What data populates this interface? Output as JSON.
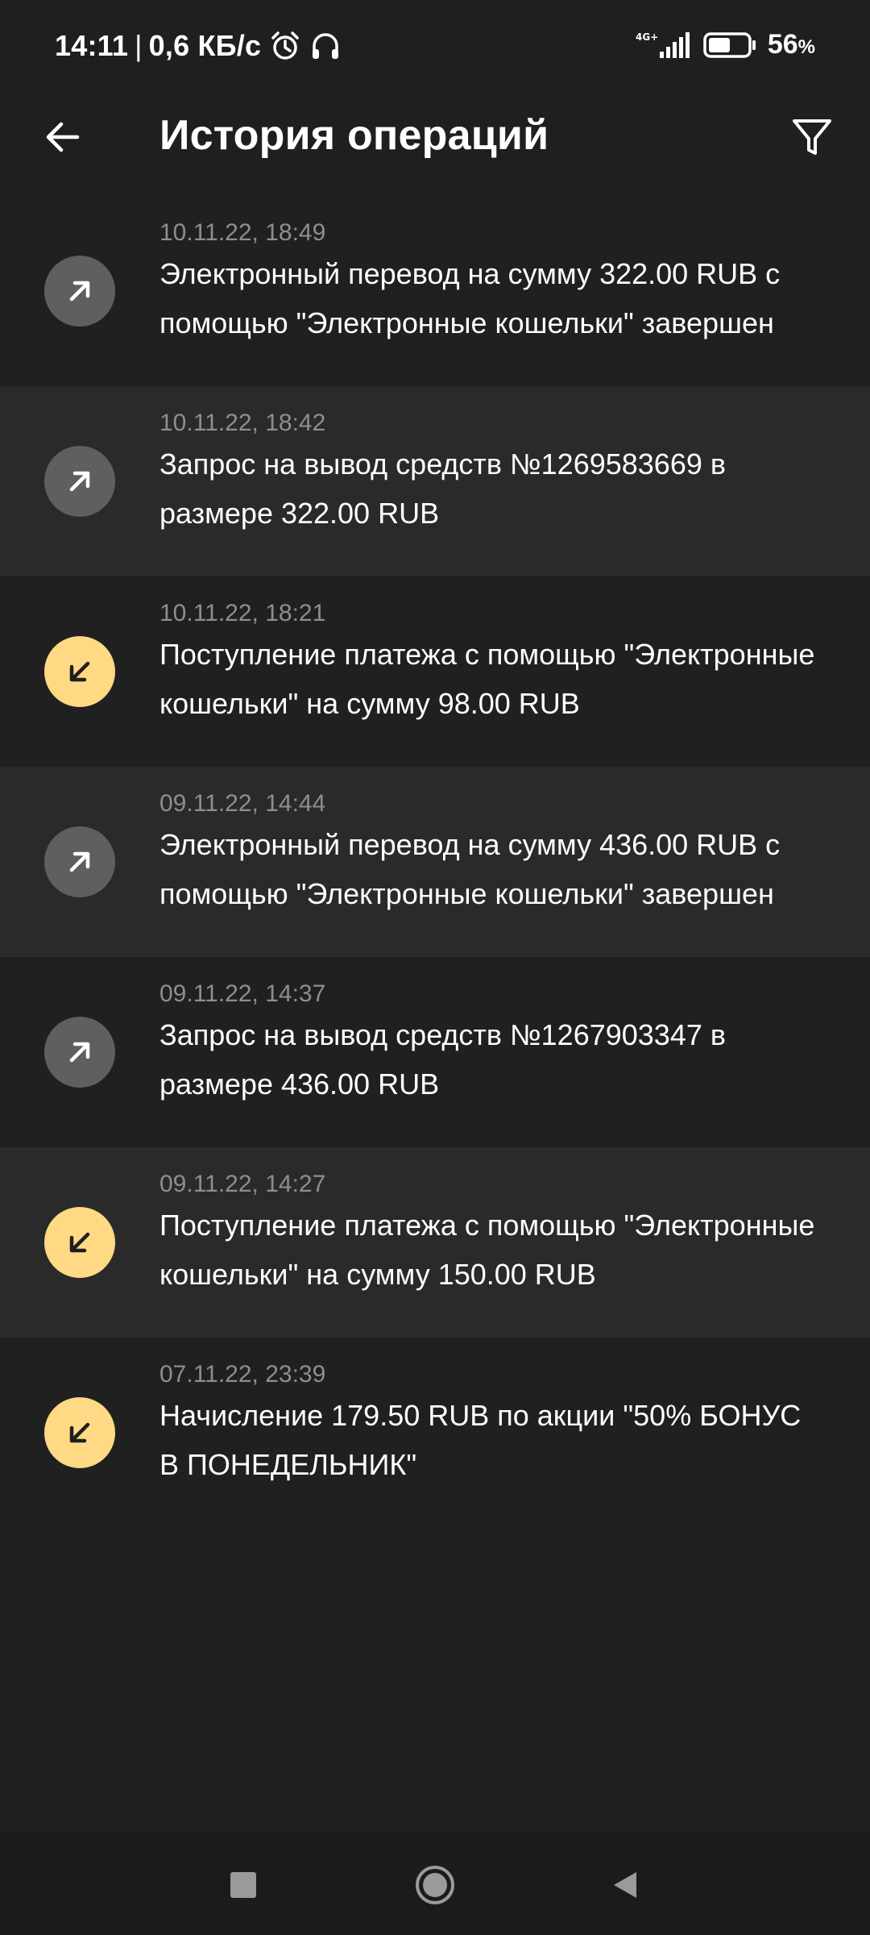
{
  "status_bar": {
    "time": "14:11",
    "separator": "|",
    "speed": "0,6 КБ/с",
    "network": "4G+",
    "battery_value": "56",
    "battery_unit": "%",
    "battery_level": 0.56
  },
  "header": {
    "title": "История операций"
  },
  "operations": [
    {
      "date": "10.11.22, 18:49",
      "text": "Электронный перевод на сумму 322.00 RUB с помощью \"Электронные кошельки\" завершен",
      "direction": "out"
    },
    {
      "date": "10.11.22, 18:42",
      "text": "Запрос на вывод средств №1269583669 в размере 322.00 RUB",
      "direction": "out"
    },
    {
      "date": "10.11.22, 18:21",
      "text": "Поступление платежа с помощью \"Электронные кошельки\" на сумму 98.00 RUB",
      "direction": "in"
    },
    {
      "date": "09.11.22, 14:44",
      "text": "Электронный перевод на сумму 436.00 RUB с помощью \"Электронные кошельки\" завершен",
      "direction": "out"
    },
    {
      "date": "09.11.22, 14:37",
      "text": "Запрос на вывод средств №1267903347 в размере 436.00 RUB",
      "direction": "out"
    },
    {
      "date": "09.11.22, 14:27",
      "text": "Поступление платежа с помощью \"Электронные кошельки\" на сумму 150.00 RUB",
      "direction": "in"
    },
    {
      "date": "07.11.22, 23:39",
      "text": "Начисление 179.50 RUB по акции \"50% БОНУС В ПОНЕДЕЛЬНИК\"",
      "direction": "in"
    }
  ],
  "icons": {
    "outgoing": "arrow-up-right-icon",
    "incoming": "arrow-down-left-icon"
  },
  "colors": {
    "background": "#1f1f1f",
    "row_alt": "#2a2a2a",
    "outgoing_icon_bg": "#5f5f5f",
    "incoming_icon_bg": "#ffd984",
    "date_text": "#8e8e8e"
  }
}
